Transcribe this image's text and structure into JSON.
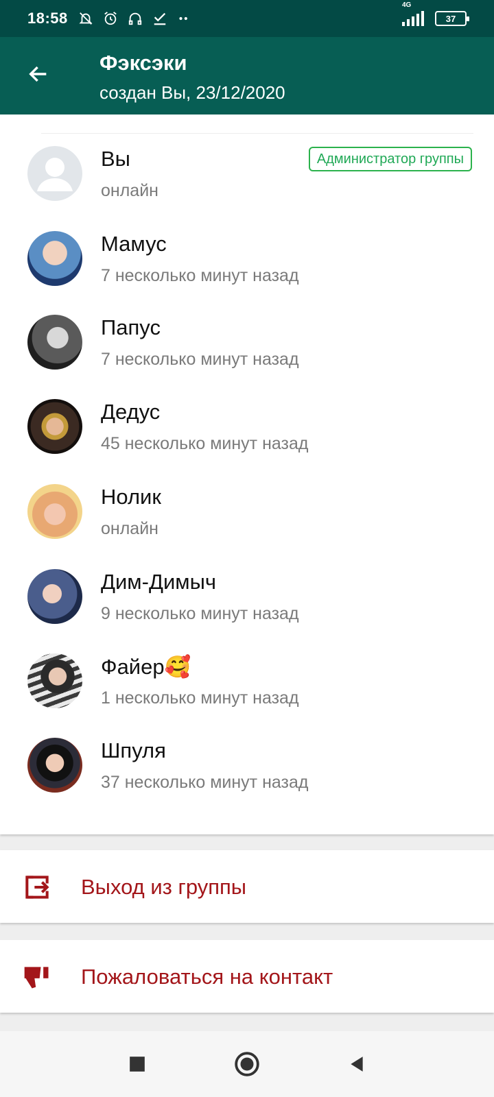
{
  "status_bar": {
    "time": "18:58",
    "network": "4G",
    "battery": "37",
    "icons": [
      "muted-bell-icon",
      "alarm-icon",
      "headphones-icon",
      "check-download-icon",
      "more-dots-icon",
      "signal-icon",
      "battery-icon"
    ]
  },
  "header": {
    "title": "Фэксэки",
    "subtitle": "создан Вы, 23/12/2020",
    "back_icon": "arrow-left-icon"
  },
  "members": [
    {
      "name": "Вы",
      "status": "онлайн",
      "badge": "Администратор группы",
      "avatar": "default-avatar",
      "color": "#e2e6ea"
    },
    {
      "name": "Мамус",
      "status": "7 несколько минут назад",
      "avatar": "photo",
      "color": "#5a8ec4"
    },
    {
      "name": "Папус",
      "status": "7 несколько минут назад",
      "avatar": "photo",
      "color": "#6b6b6b"
    },
    {
      "name": "Дедус",
      "status": "45 несколько минут назад",
      "avatar": "photo",
      "color": "#3b2a22"
    },
    {
      "name": "Нолик",
      "status": "онлайн",
      "avatar": "photo",
      "color": "#e8a872"
    },
    {
      "name": "Дим-Димыч",
      "status": "9 несколько минут назад",
      "avatar": "photo",
      "color": "#4a5d8c"
    },
    {
      "name": "Файер🥰",
      "status": "1 несколько минут назад",
      "avatar": "photo",
      "color": "#7c6f66"
    },
    {
      "name": "Шпуля",
      "status": "37 несколько минут назад",
      "avatar": "photo",
      "color": "#2c2c38"
    }
  ],
  "actions": {
    "exit_group": {
      "label": "Выход из группы",
      "icon": "exit-icon"
    },
    "report": {
      "label": "Пожаловаться на контакт",
      "icon": "thumbs-down-icon"
    }
  },
  "colors": {
    "header": "#075e54",
    "status_bar": "#034a45",
    "accent_green": "#1fa855",
    "danger": "#a3161a"
  },
  "nav": {
    "icons": [
      "recents-square-icon",
      "home-circle-icon",
      "back-triangle-icon"
    ]
  }
}
